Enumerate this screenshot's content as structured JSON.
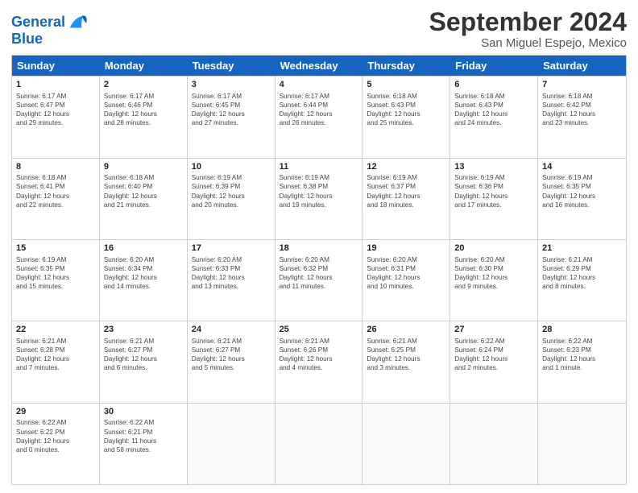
{
  "logo": {
    "line1": "General",
    "line2": "Blue"
  },
  "header": {
    "month": "September 2024",
    "location": "San Miguel Espejo, Mexico"
  },
  "days": [
    "Sunday",
    "Monday",
    "Tuesday",
    "Wednesday",
    "Thursday",
    "Friday",
    "Saturday"
  ],
  "weeks": [
    [
      {
        "num": "1",
        "sunrise": "6:17 AM",
        "sunset": "6:47 PM",
        "daylight": "12 hours and 29 minutes."
      },
      {
        "num": "2",
        "sunrise": "6:17 AM",
        "sunset": "6:46 PM",
        "daylight": "12 hours and 28 minutes."
      },
      {
        "num": "3",
        "sunrise": "6:17 AM",
        "sunset": "6:45 PM",
        "daylight": "12 hours and 27 minutes."
      },
      {
        "num": "4",
        "sunrise": "6:17 AM",
        "sunset": "6:44 PM",
        "daylight": "12 hours and 26 minutes."
      },
      {
        "num": "5",
        "sunrise": "6:18 AM",
        "sunset": "6:43 PM",
        "daylight": "12 hours and 25 minutes."
      },
      {
        "num": "6",
        "sunrise": "6:18 AM",
        "sunset": "6:43 PM",
        "daylight": "12 hours and 24 minutes."
      },
      {
        "num": "7",
        "sunrise": "6:18 AM",
        "sunset": "6:42 PM",
        "daylight": "12 hours and 23 minutes."
      }
    ],
    [
      {
        "num": "8",
        "sunrise": "6:18 AM",
        "sunset": "6:41 PM",
        "daylight": "12 hours and 22 minutes."
      },
      {
        "num": "9",
        "sunrise": "6:18 AM",
        "sunset": "6:40 PM",
        "daylight": "12 hours and 21 minutes."
      },
      {
        "num": "10",
        "sunrise": "6:19 AM",
        "sunset": "6:39 PM",
        "daylight": "12 hours and 20 minutes."
      },
      {
        "num": "11",
        "sunrise": "6:19 AM",
        "sunset": "6:38 PM",
        "daylight": "12 hours and 19 minutes."
      },
      {
        "num": "12",
        "sunrise": "6:19 AM",
        "sunset": "6:37 PM",
        "daylight": "12 hours and 18 minutes."
      },
      {
        "num": "13",
        "sunrise": "6:19 AM",
        "sunset": "6:36 PM",
        "daylight": "12 hours and 17 minutes."
      },
      {
        "num": "14",
        "sunrise": "6:19 AM",
        "sunset": "6:35 PM",
        "daylight": "12 hours and 16 minutes."
      }
    ],
    [
      {
        "num": "15",
        "sunrise": "6:19 AM",
        "sunset": "6:35 PM",
        "daylight": "12 hours and 15 minutes."
      },
      {
        "num": "16",
        "sunrise": "6:20 AM",
        "sunset": "6:34 PM",
        "daylight": "12 hours and 14 minutes."
      },
      {
        "num": "17",
        "sunrise": "6:20 AM",
        "sunset": "6:33 PM",
        "daylight": "12 hours and 13 minutes."
      },
      {
        "num": "18",
        "sunrise": "6:20 AM",
        "sunset": "6:32 PM",
        "daylight": "12 hours and 11 minutes."
      },
      {
        "num": "19",
        "sunrise": "6:20 AM",
        "sunset": "6:31 PM",
        "daylight": "12 hours and 10 minutes."
      },
      {
        "num": "20",
        "sunrise": "6:20 AM",
        "sunset": "6:30 PM",
        "daylight": "12 hours and 9 minutes."
      },
      {
        "num": "21",
        "sunrise": "6:21 AM",
        "sunset": "6:29 PM",
        "daylight": "12 hours and 8 minutes."
      }
    ],
    [
      {
        "num": "22",
        "sunrise": "6:21 AM",
        "sunset": "6:28 PM",
        "daylight": "12 hours and 7 minutes."
      },
      {
        "num": "23",
        "sunrise": "6:21 AM",
        "sunset": "6:27 PM",
        "daylight": "12 hours and 6 minutes."
      },
      {
        "num": "24",
        "sunrise": "6:21 AM",
        "sunset": "6:27 PM",
        "daylight": "12 hours and 5 minutes."
      },
      {
        "num": "25",
        "sunrise": "6:21 AM",
        "sunset": "6:26 PM",
        "daylight": "12 hours and 4 minutes."
      },
      {
        "num": "26",
        "sunrise": "6:21 AM",
        "sunset": "6:25 PM",
        "daylight": "12 hours and 3 minutes."
      },
      {
        "num": "27",
        "sunrise": "6:22 AM",
        "sunset": "6:24 PM",
        "daylight": "12 hours and 2 minutes."
      },
      {
        "num": "28",
        "sunrise": "6:22 AM",
        "sunset": "6:23 PM",
        "daylight": "12 hours and 1 minute."
      }
    ],
    [
      {
        "num": "29",
        "sunrise": "6:22 AM",
        "sunset": "6:22 PM",
        "daylight": "12 hours and 0 minutes."
      },
      {
        "num": "30",
        "sunrise": "6:22 AM",
        "sunset": "6:21 PM",
        "daylight": "11 hours and 58 minutes."
      },
      null,
      null,
      null,
      null,
      null
    ]
  ]
}
